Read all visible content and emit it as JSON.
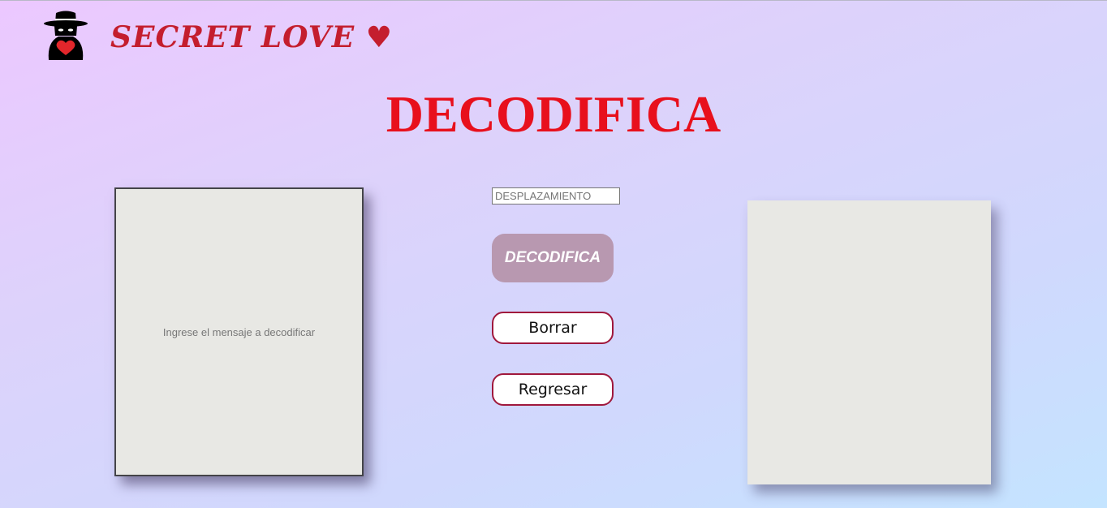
{
  "header": {
    "brand": "SECRET LOVE ♥",
    "logo_icon": "spy-heart-icon"
  },
  "main": {
    "title": "DECODIFICA",
    "input_placeholder": "Ingrese el mensaje a decodificar",
    "shift_placeholder": "DESPLAZAMIENTO",
    "decode_button": "DECODIFICA",
    "clear_button": "Borrar",
    "back_button": "Regresar",
    "output_text": ""
  },
  "colors": {
    "title": "#e8101c",
    "brand": "#c41e2e",
    "decode_button_bg": "#b898b0",
    "button_border": "#a0183c",
    "panel_bg": "#e8e8e4"
  }
}
